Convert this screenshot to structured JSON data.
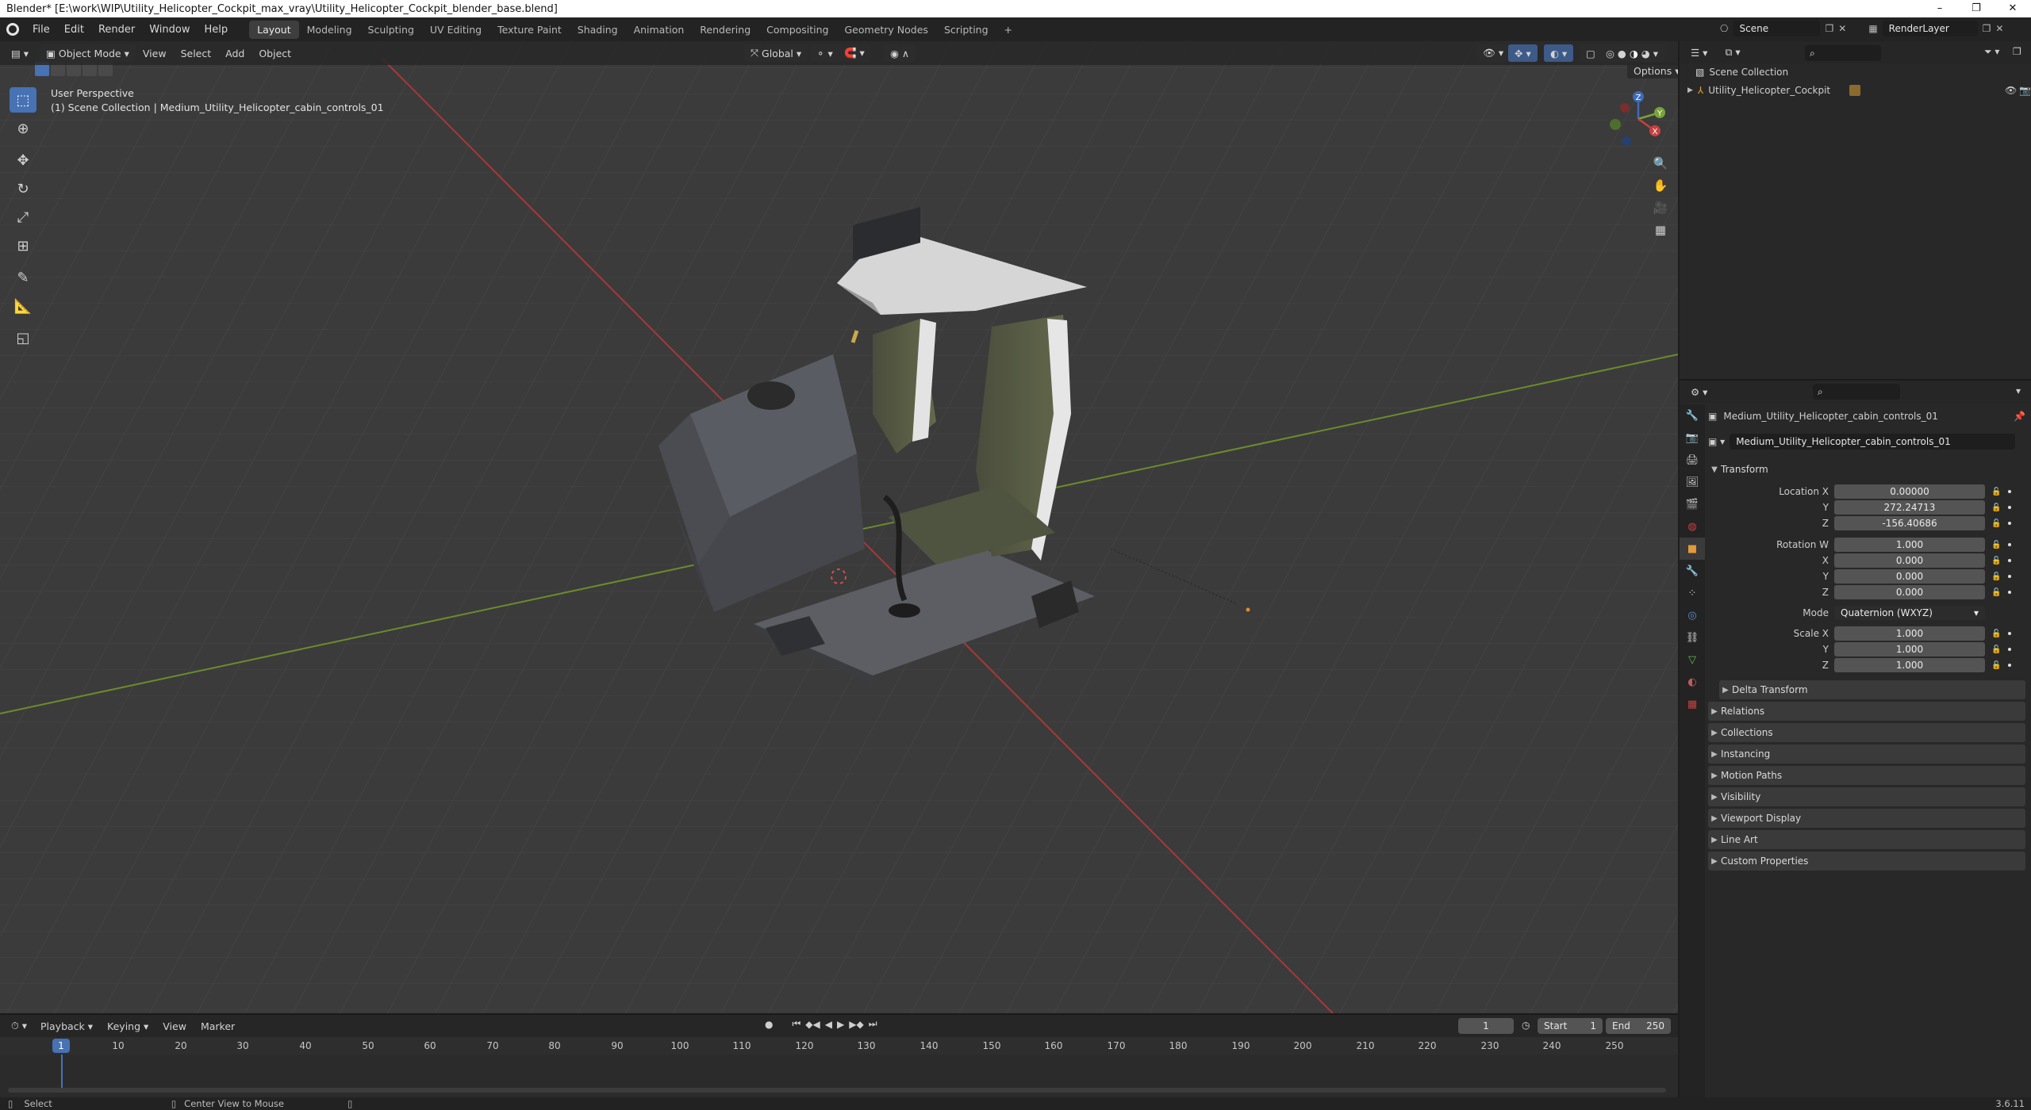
{
  "titlebar": {
    "title": "Blender* [E:\\work\\WIP\\Utility_Helicopter_Cockpit_max_vray\\Utility_Helicopter_Cockpit_blender_base.blend]"
  },
  "menu": {
    "items": [
      "File",
      "Edit",
      "Render",
      "Window",
      "Help"
    ]
  },
  "workspaces": [
    "Layout",
    "Modeling",
    "Sculpting",
    "UV Editing",
    "Texture Paint",
    "Shading",
    "Animation",
    "Rendering",
    "Compositing",
    "Geometry Nodes",
    "Scripting"
  ],
  "top_right": {
    "scene": "Scene",
    "render_layer": "RenderLayer"
  },
  "viewport": {
    "mode": "Object Mode",
    "menus": [
      "View",
      "Select",
      "Add",
      "Object"
    ],
    "transform_orientation": "Global",
    "options_label": "Options",
    "perspective_label": "User Perspective",
    "collection_label": "(1) Scene Collection | Medium_Utility_Helicopter_cabin_controls_01",
    "gizmo": {
      "x": "X",
      "y": "Y",
      "z": "Z"
    }
  },
  "outliner": {
    "root": "Scene Collection",
    "items": [
      {
        "name": "Utility_Helicopter_Cockpit"
      }
    ]
  },
  "properties": {
    "object_name": "Medium_Utility_Helicopter_cabin_controls_01",
    "data_name": "Medium_Utility_Helicopter_cabin_controls_01",
    "transform_title": "Transform",
    "location": {
      "label_x": "Location X",
      "label_y": "Y",
      "label_z": "Z",
      "x": "0.00000",
      "y": "272.24713",
      "z": "-156.40686"
    },
    "rotation": {
      "label_w": "Rotation W",
      "label_x": "X",
      "label_y": "Y",
      "label_z": "Z",
      "w": "1.000",
      "x": "0.000",
      "y": "0.000",
      "z": "0.000"
    },
    "mode": {
      "label": "Mode",
      "value": "Quaternion (WXYZ)"
    },
    "scale": {
      "label_x": "Scale X",
      "label_y": "Y",
      "label_z": "Z",
      "x": "1.000",
      "y": "1.000",
      "z": "1.000"
    },
    "delta_transform": "Delta Transform",
    "panels": [
      "Relations",
      "Collections",
      "Instancing",
      "Motion Paths",
      "Visibility",
      "Viewport Display",
      "Line Art",
      "Custom Properties"
    ]
  },
  "timeline": {
    "menus": [
      "Playback",
      "Keying",
      "View",
      "Marker"
    ],
    "current_frame": "1",
    "start_label": "Start",
    "start": "1",
    "end_label": "End",
    "end": "250",
    "ticks": [
      "10",
      "20",
      "30",
      "40",
      "50",
      "60",
      "70",
      "80",
      "90",
      "100",
      "110",
      "120",
      "130",
      "140",
      "150",
      "160",
      "170",
      "180",
      "190",
      "200",
      "210",
      "220",
      "230",
      "240",
      "250"
    ]
  },
  "statusbar": {
    "select": "Select",
    "center_view": "Center View to Mouse",
    "version": "3.6.11"
  }
}
